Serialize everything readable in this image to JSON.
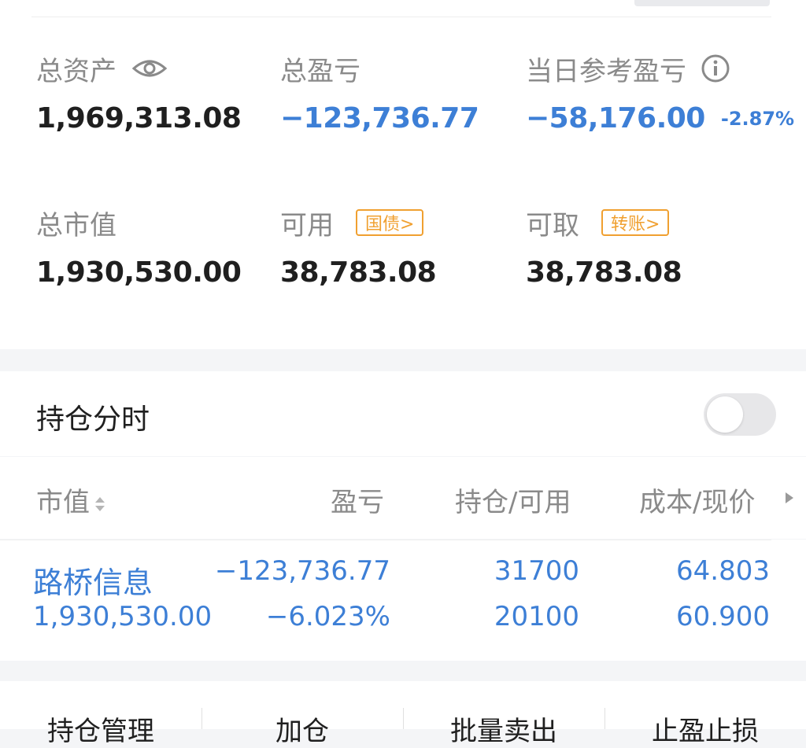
{
  "summary": {
    "total_assets": {
      "label": "总资产",
      "value": "1,969,313.08"
    },
    "total_pnl": {
      "label": "总盈亏",
      "value": "−123,736.77"
    },
    "daily_pnl": {
      "label": "当日参考盈亏",
      "value": "−58,176.00",
      "percent": "-2.87%"
    },
    "market_value": {
      "label": "总市值",
      "value": "1,930,530.00"
    },
    "available": {
      "label": "可用",
      "tag": "国债>",
      "value": "38,783.08"
    },
    "withdrawable": {
      "label": "可取",
      "tag": "转账>",
      "value": "38,783.08"
    }
  },
  "timeshare": {
    "title": "持仓分时",
    "enabled": false
  },
  "table": {
    "headers": [
      "市值",
      "盈亏",
      "持仓/可用",
      "成本/现价"
    ],
    "rows": [
      {
        "name": "路桥信息",
        "market_value": "1,930,530.00",
        "pnl": "−123,736.77",
        "pnl_pct": "−6.023%",
        "position": "31700",
        "available": "20100",
        "cost": "64.803",
        "price": "60.900"
      }
    ]
  },
  "actions": [
    "持仓管理",
    "加仓",
    "批量卖出",
    "止盈止损"
  ],
  "colors": {
    "accent_blue": "#3d7fd6",
    "tag_orange": "#f0a030",
    "label_gray": "#8a8a8a"
  }
}
